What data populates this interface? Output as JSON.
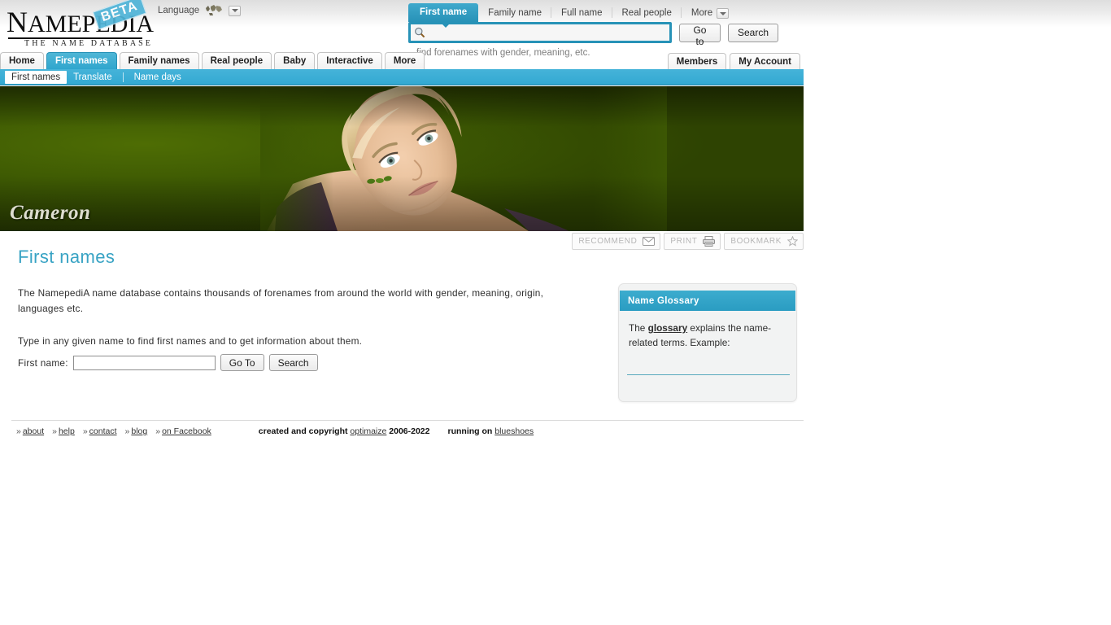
{
  "brand": {
    "logo_text": "NAMEPEDIA",
    "logo_tagline": "THE NAME DATABASE",
    "beta_badge": "BETA"
  },
  "language": {
    "label": "Language",
    "globe_icon": "globe-icon",
    "dropdown_icon": "chevron-down-icon"
  },
  "search": {
    "tabs": [
      {
        "label": "First name",
        "active": true
      },
      {
        "label": "Family name",
        "active": false
      },
      {
        "label": "Full name",
        "active": false
      },
      {
        "label": "Real people",
        "active": false
      },
      {
        "label": "More",
        "active": false
      }
    ],
    "input_value": "",
    "placeholder": "",
    "search_icon": "search-icon",
    "goto_label": "Go to",
    "search_label": "Search",
    "hint": "find forenames with gender, meaning, etc."
  },
  "mainnav": {
    "items": [
      {
        "label": "Home",
        "active": false
      },
      {
        "label": "First names",
        "active": true
      },
      {
        "label": "Family names",
        "active": false
      },
      {
        "label": "Real people",
        "active": false
      },
      {
        "label": "Baby",
        "active": false
      },
      {
        "label": "Interactive",
        "active": false
      },
      {
        "label": "More",
        "active": false
      }
    ],
    "right_items": [
      {
        "label": "Members"
      },
      {
        "label": "My Account"
      }
    ]
  },
  "subnav": {
    "items": [
      {
        "label": "First names",
        "active": true
      },
      {
        "label": "Translate",
        "active": false
      },
      {
        "label": "Name days",
        "active": false
      }
    ]
  },
  "banner": {
    "name": "Cameron",
    "image_alt": "portrait-photo-blonde-woman"
  },
  "actions": [
    {
      "label": "RECOMMEND",
      "icon": "envelope-icon"
    },
    {
      "label": "PRINT",
      "icon": "printer-icon"
    },
    {
      "label": "BOOKMARK",
      "icon": "star-icon"
    }
  ],
  "main": {
    "heading": "First names",
    "intro": "The NamepediA name database contains thousands of forenames from around the world with gender, meaning, origin, languages etc.",
    "instruction": "Type in any given name to find first names and to get information about them.",
    "form": {
      "label": "First name:",
      "value": "",
      "goto_label": "Go To",
      "search_label": "Search"
    }
  },
  "glossary": {
    "title": "Name Glossary",
    "text_before": "The ",
    "link": "glossary",
    "text_after": " explains the name-related terms. Example:"
  },
  "footer": {
    "links": [
      {
        "chev": "»",
        "label": "about"
      },
      {
        "chev": "»",
        "label": "help"
      },
      {
        "chev": "»",
        "label": "contact"
      },
      {
        "chev": "»",
        "label": "blog"
      },
      {
        "chev": "»",
        "label": "on Facebook"
      }
    ],
    "copyright_prefix": "created and copyright ",
    "copyright_link": "optimaize",
    "copyright_years": " 2006-2022",
    "running_prefix": "running on ",
    "running_link": "blueshoes"
  },
  "colors": {
    "accent_teal": "#2792b7",
    "nav_teal": "#33a9d2",
    "heading_blue": "#38a3c4",
    "banner_green": "#3f5b03"
  }
}
